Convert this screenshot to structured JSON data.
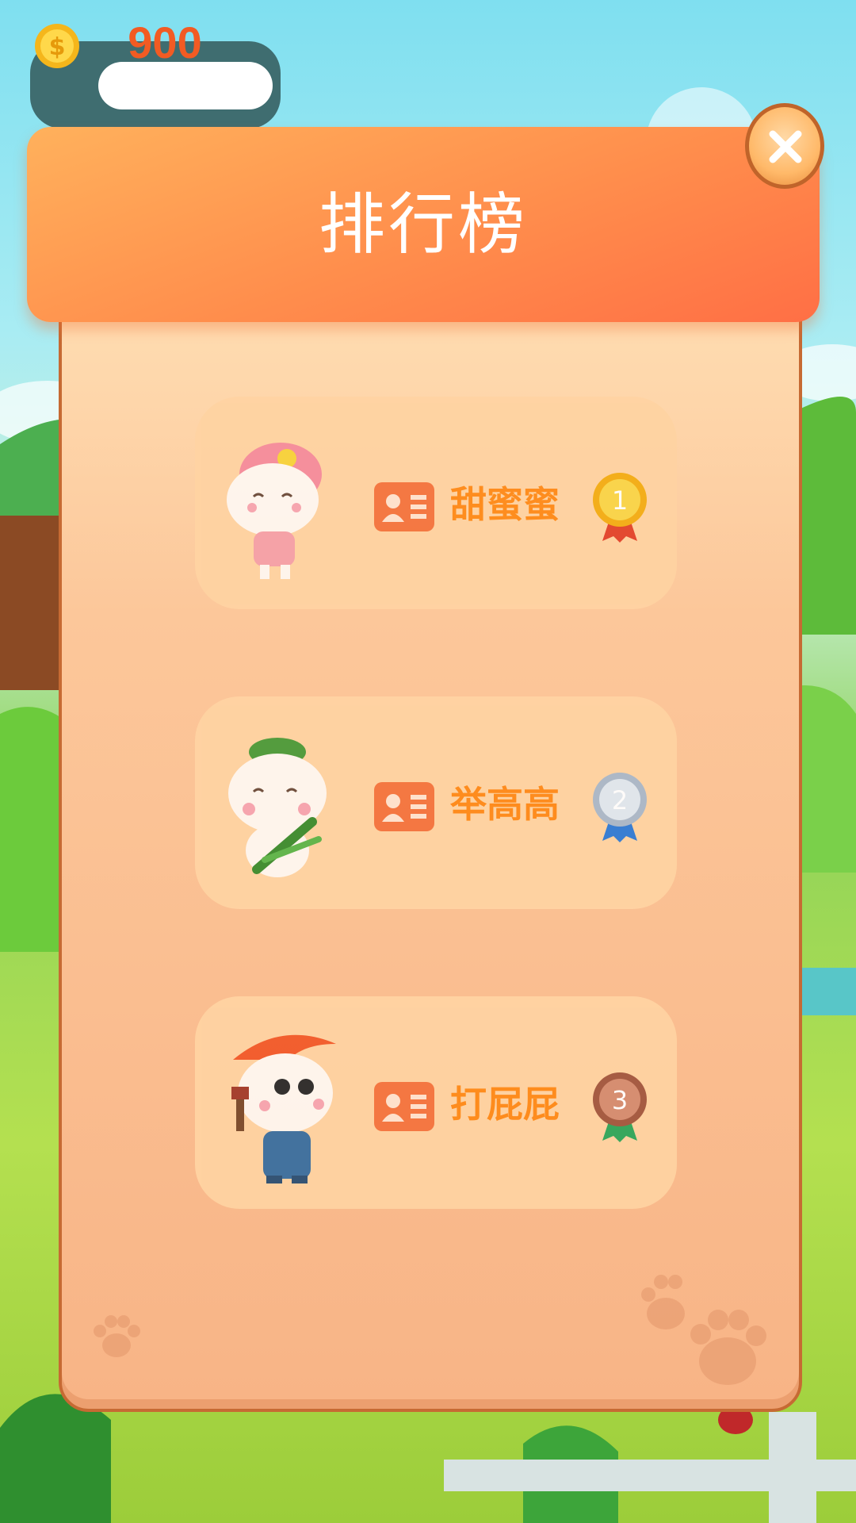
{
  "coins": {
    "value": "900"
  },
  "leaderboard": {
    "title": "排行榜",
    "entries": [
      {
        "name": "甜蜜蜜",
        "rank": "1"
      },
      {
        "name": "举高高",
        "rank": "2"
      },
      {
        "name": "打屁屁",
        "rank": "3"
      }
    ]
  },
  "colors": {
    "header": "#ff8d4c",
    "name_text": "#ff8a18",
    "gold": "#f5c21e",
    "silver": "#c9d4e0",
    "bronze": "#c07a5f"
  }
}
